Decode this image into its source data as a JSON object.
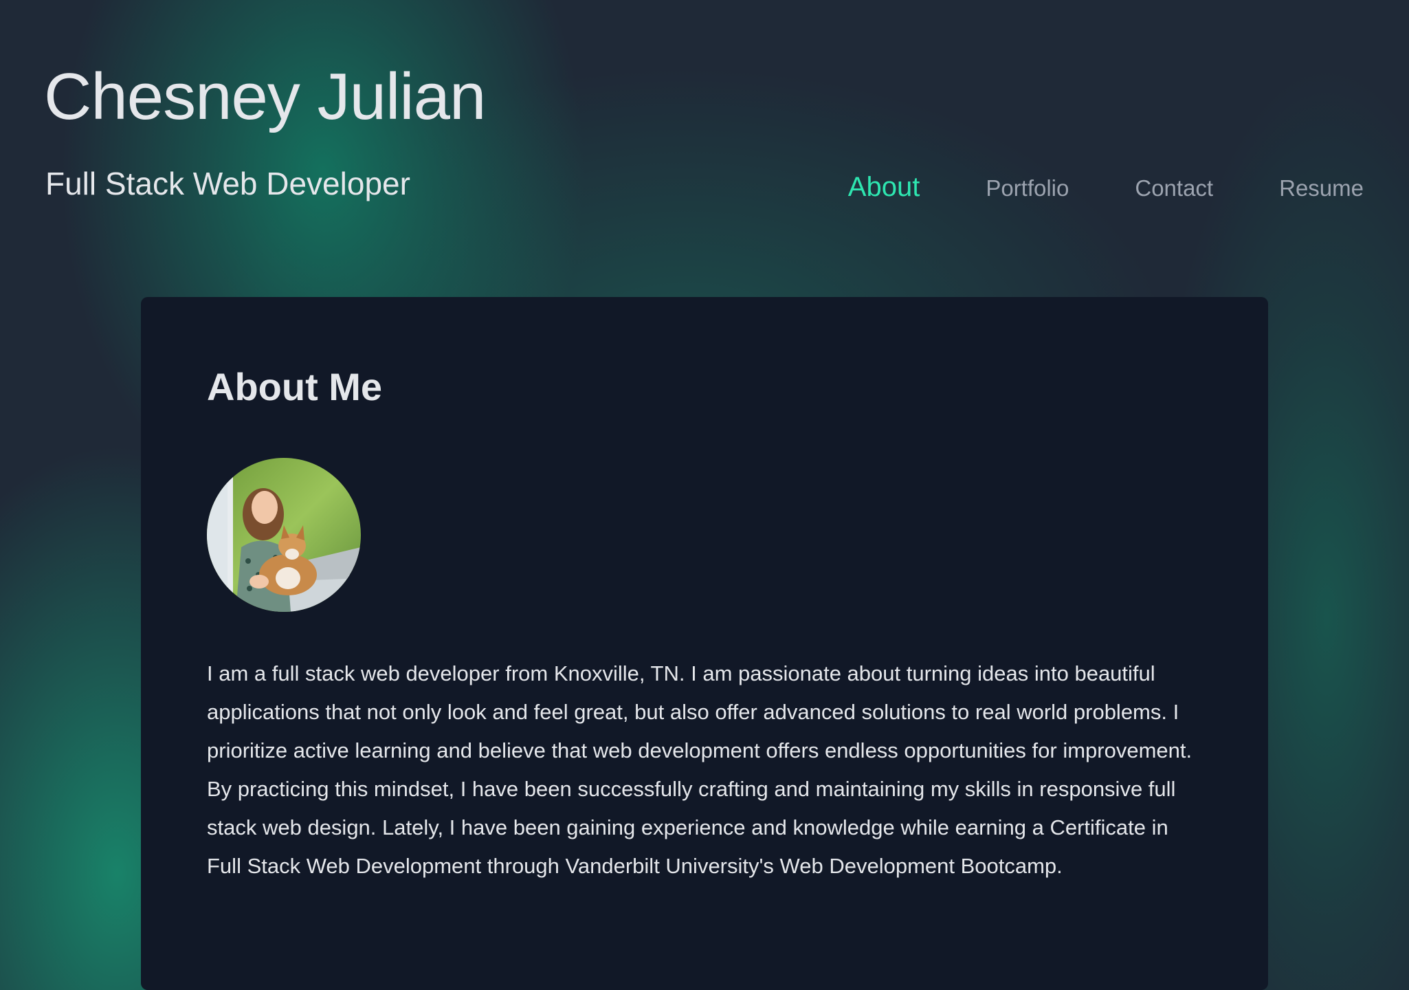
{
  "header": {
    "name": "Chesney Julian",
    "tagline": "Full Stack Web Developer"
  },
  "nav": {
    "items": [
      {
        "label": "About",
        "active": true
      },
      {
        "label": "Portfolio",
        "active": false
      },
      {
        "label": "Contact",
        "active": false
      },
      {
        "label": "Resume",
        "active": false
      }
    ]
  },
  "about": {
    "heading": "About Me",
    "avatar_alt": "profile-photo",
    "bio": "I am a full stack web developer from Knoxville, TN. I am passionate about turning ideas into beautiful applications that not only look and feel great, but also offer advanced solutions to real world problems. I prioritize active learning and believe that web development offers endless opportunities for improvement. By practicing this mindset, I have been successfully crafting and maintaining my skills in responsive full stack web design. Lately, I have been gaining experience and knowledge while earning a Certificate in Full Stack Web Development through Vanderbilt University's Web Development Bootcamp."
  },
  "colors": {
    "background": "#1f2937",
    "card": "#111827",
    "accent": "#2ee6b0",
    "nav_inactive": "#9ca3af",
    "text": "#e5e7eb",
    "glow": "#127d64"
  }
}
